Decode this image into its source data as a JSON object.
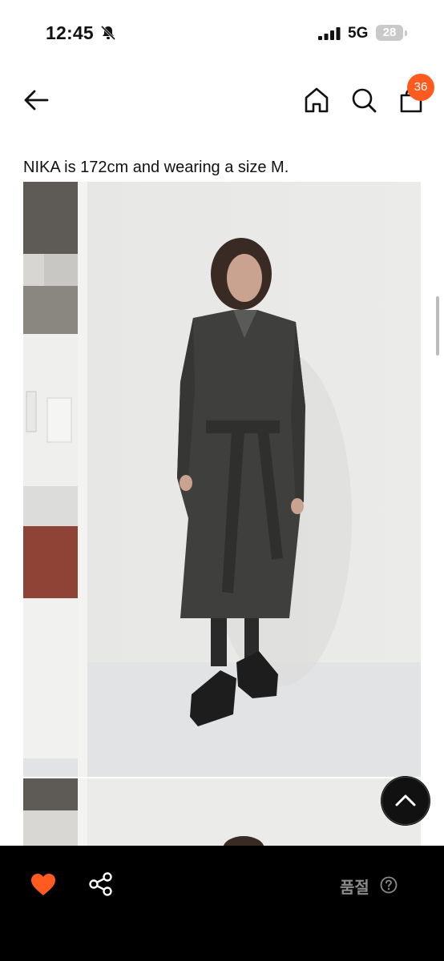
{
  "status_bar": {
    "time": "12:45",
    "network": "5G",
    "battery": "28"
  },
  "nav": {
    "cart_count": "36",
    "icons": [
      "back-arrow-icon",
      "home-icon",
      "search-icon",
      "shopping-bag-icon"
    ]
  },
  "product": {
    "model_caption": "NIKA is 172cm and wearing a size M."
  },
  "bottom_bar": {
    "sold_out_label": "품절",
    "icons": [
      "heart-icon",
      "share-icon",
      "help-icon"
    ]
  },
  "colors": {
    "accent": "#ff5a1f",
    "bar_background": "#000000",
    "sold_out_text": "#8a8a8a"
  }
}
